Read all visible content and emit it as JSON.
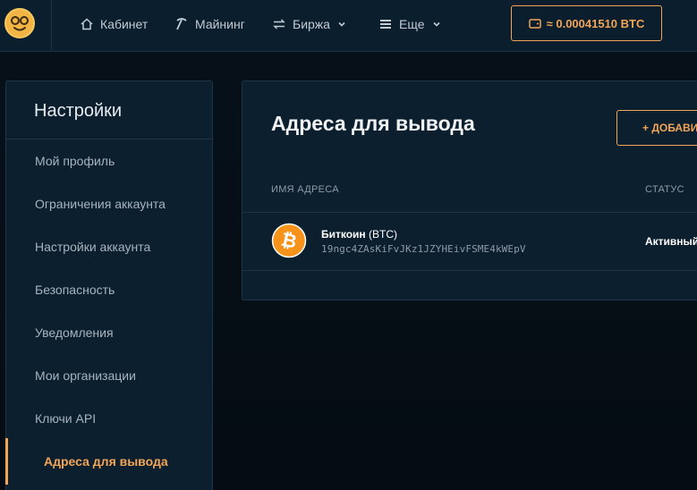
{
  "header": {
    "nav": [
      {
        "label": "Кабинет",
        "icon": "home-icon"
      },
      {
        "label": "Майнинг",
        "icon": "pickaxe-icon"
      },
      {
        "label": "Биржа",
        "icon": "exchange-icon"
      },
      {
        "label": "Еще",
        "icon": "stack-icon"
      }
    ],
    "balance": "≈ 0.00041510 BTC"
  },
  "sidebar": {
    "title": "Настройки",
    "items": [
      {
        "label": "Мой профиль"
      },
      {
        "label": "Ограничения аккаунта"
      },
      {
        "label": "Настройки аккаунта"
      },
      {
        "label": "Безопасность"
      },
      {
        "label": "Уведомления"
      },
      {
        "label": "Мои организации"
      },
      {
        "label": "Ключи API"
      },
      {
        "label": "Адреса для вывода",
        "active": true
      }
    ]
  },
  "main": {
    "title": "Адреса для вывода",
    "add_button": "+ ДОБАВИТЬ",
    "columns": [
      "ИМЯ АДРЕСА",
      "СТАТУС"
    ],
    "rows": [
      {
        "name": "Биткоин",
        "ticker": "(BTC)",
        "address": "19ngc4ZAsKiFvJKz1JZYHEivFSME4kWEpV",
        "status": "Активный"
      }
    ]
  },
  "colors": {
    "accent": "#f2a556",
    "background": "#07111a",
    "panel": "#0b1f2e",
    "bitcoin": "#f7931a"
  }
}
